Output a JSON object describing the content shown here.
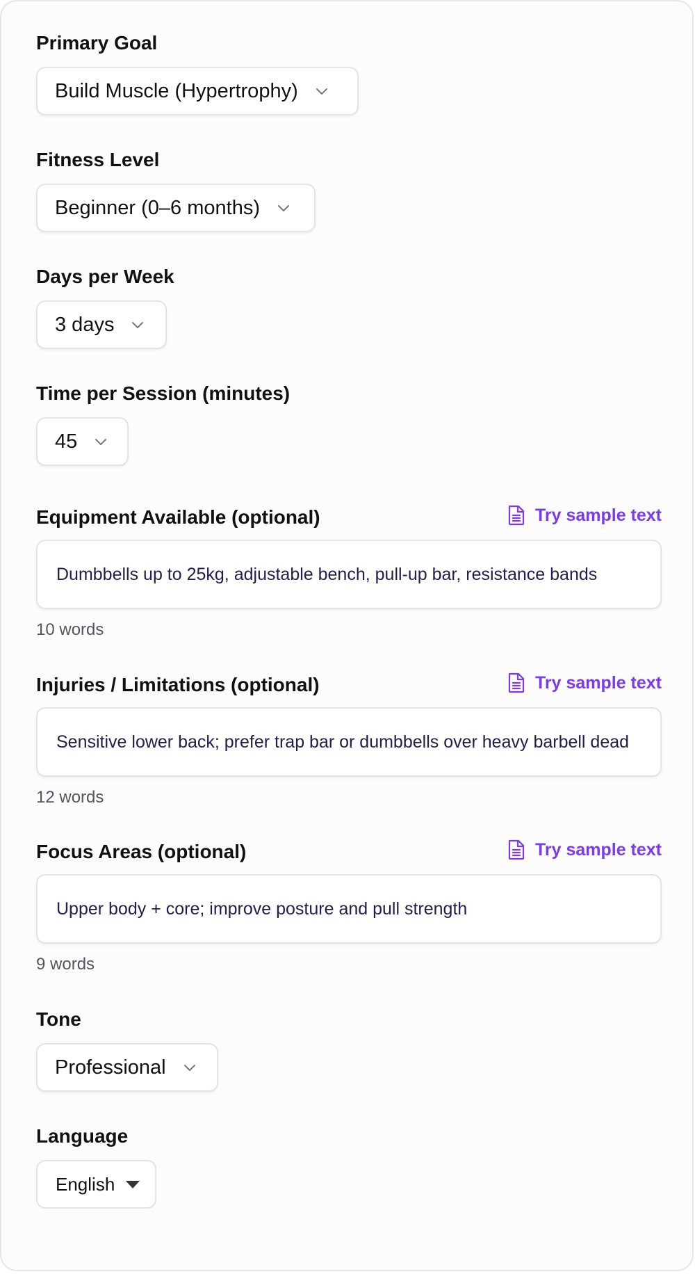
{
  "form": {
    "primary_goal": {
      "label": "Primary Goal",
      "value": "Build Muscle (Hypertrophy)",
      "icon": "chevron-down-icon"
    },
    "fitness_level": {
      "label": "Fitness Level",
      "value": "Beginner (0–6 months)",
      "icon": "chevron-down-icon"
    },
    "days_per_week": {
      "label": "Days per Week",
      "value": "3 days",
      "icon": "chevron-down-icon"
    },
    "time_per_session": {
      "label": "Time per Session (minutes)",
      "value": "45",
      "icon": "chevron-down-icon"
    },
    "equipment": {
      "label": "Equipment Available (optional)",
      "sample_link": "Try sample text",
      "value": "Dumbbells up to 25kg, adjustable bench, pull-up bar, resistance bands",
      "word_count": "10 words"
    },
    "injuries": {
      "label": "Injuries / Limitations (optional)",
      "sample_link": "Try sample text",
      "value": "Sensitive lower back; prefer trap bar or dumbbells over heavy barbell dead",
      "word_count": "12 words"
    },
    "focus_areas": {
      "label": "Focus Areas (optional)",
      "sample_link": "Try sample text",
      "value": "Upper body + core; improve posture and pull strength",
      "word_count": "9 words"
    },
    "tone": {
      "label": "Tone",
      "value": "Professional",
      "icon": "chevron-down-icon"
    },
    "language": {
      "label": "Language",
      "value": "English",
      "icon": "caret-down-icon"
    }
  },
  "colors": {
    "accent": "#7c3aed",
    "text": "#111114",
    "input_text": "#1f1f4d",
    "muted": "#555560",
    "border": "#e4e4e7"
  }
}
